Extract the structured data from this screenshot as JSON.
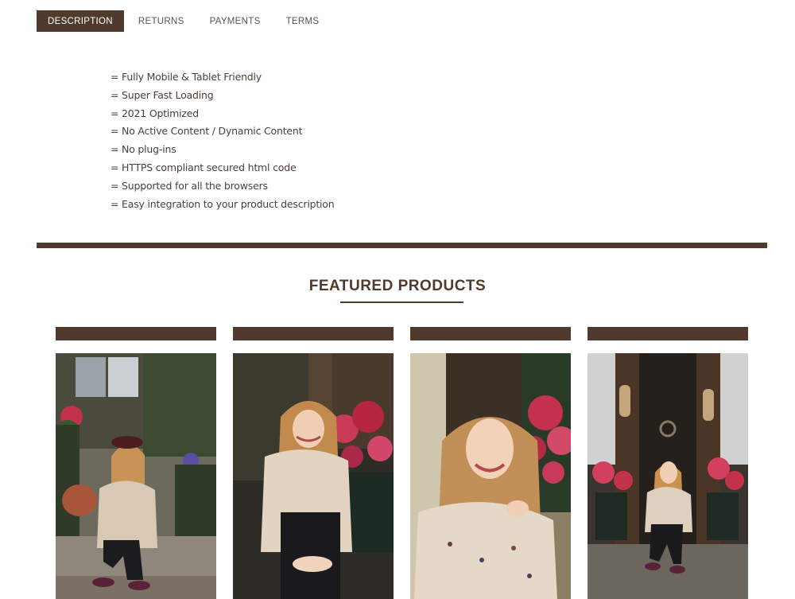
{
  "tabs": [
    {
      "label": "DESCRIPTION",
      "active": true
    },
    {
      "label": "RETURNS",
      "active": false
    },
    {
      "label": "PAYMENTS",
      "active": false
    },
    {
      "label": "TERMS",
      "active": false
    }
  ],
  "features": [
    "= Fully Mobile & Tablet Friendly",
    "= Super Fast Loading",
    "= 2021 Optimized",
    "= No Active Content / Dynamic Content",
    "= No plug-ins",
    "= HTTPS compliant secured html code",
    "= Supported for all the browsers",
    "= Easy integration to your product description"
  ],
  "featured": {
    "title": "FEATURED PRODUCTS"
  },
  "colors": {
    "accent": "#4f3a2d"
  },
  "products": [
    {
      "image": "woman-sitting-on-steps-with-hat-photo"
    },
    {
      "image": "woman-smiling-by-red-hydrangeas-photo"
    },
    {
      "image": "woman-closeup-smiling-by-flowers-photo"
    },
    {
      "image": "woman-sitting-at-doorway-with-flowers-photo"
    }
  ]
}
